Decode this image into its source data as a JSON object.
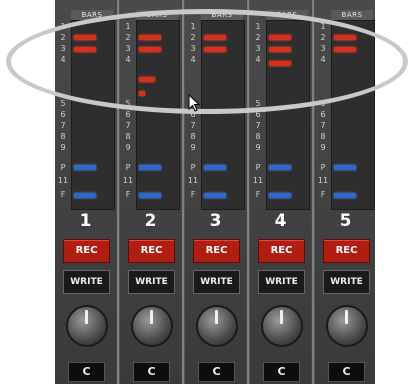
{
  "mixer": {
    "header_label": "BARS",
    "row_numbers": [
      "1",
      "2",
      "3",
      "4",
      "5",
      "6",
      "7",
      "8",
      "9",
      "P",
      "11",
      "F"
    ],
    "channels": [
      {
        "number": "1",
        "rec_label": "REC",
        "write_label": "WRITE",
        "pan_label": "C"
      },
      {
        "number": "2",
        "rec_label": "REC",
        "write_label": "WRITE",
        "pan_label": "C"
      },
      {
        "number": "3",
        "rec_label": "REC",
        "write_label": "WRITE",
        "pan_label": "C"
      },
      {
        "number": "4",
        "rec_label": "REC",
        "write_label": "WRITE",
        "pan_label": "C"
      },
      {
        "number": "5",
        "rec_label": "REC",
        "write_label": "WRITE",
        "pan_label": "C"
      }
    ]
  },
  "colors": {
    "record": "#b11d10",
    "meter_red": "#d83018",
    "meter_blue": "#2e68c8",
    "highlight_ellipse": "#c9c9c9"
  },
  "icons": {
    "cursor": "arrow-cursor-icon",
    "knob": "pan-knob-icon"
  }
}
